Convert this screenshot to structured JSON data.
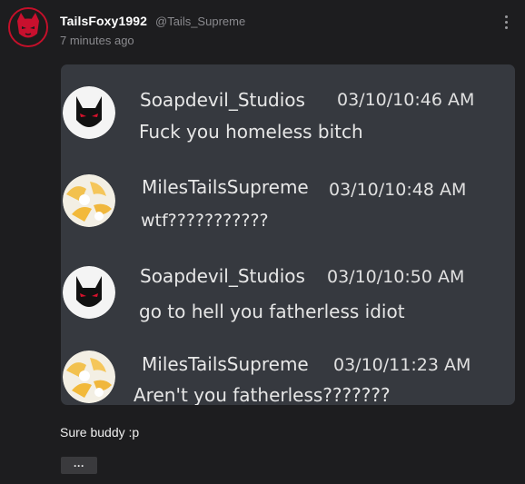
{
  "post": {
    "author_name": "TailsFoxy1992",
    "author_handle": "@Tails_Supreme",
    "posted_ago": "7 minutes ago",
    "caption": "Sure buddy :p",
    "expand_label": "···"
  },
  "embed": {
    "messages": [
      {
        "author": "Soapdevil_Studios",
        "timestamp": "03/10/10:46 AM",
        "text": "Fuck you homeless bitch",
        "avatar": "black-cat-mask-avatar"
      },
      {
        "author": "MilesTailsSupreme",
        "timestamp": "03/10/10:48 AM",
        "text": "wtf???????????",
        "avatar": "tails-fox-avatar"
      },
      {
        "author": "Soapdevil_Studios",
        "timestamp": "03/10/10:50 AM",
        "text": "go to hell you fatherless idiot",
        "avatar": "black-cat-mask-avatar"
      },
      {
        "author": "MilesTailsSupreme",
        "timestamp": "03/10/11:23 AM",
        "text": "Aren't you fatherless???????",
        "avatar": "tails-fox-avatar"
      }
    ]
  },
  "colors": {
    "background": "#1d1d1f",
    "embed_background": "#36393f",
    "avatar_ring": "#c4102a",
    "muted_text": "#8a8a8e"
  }
}
